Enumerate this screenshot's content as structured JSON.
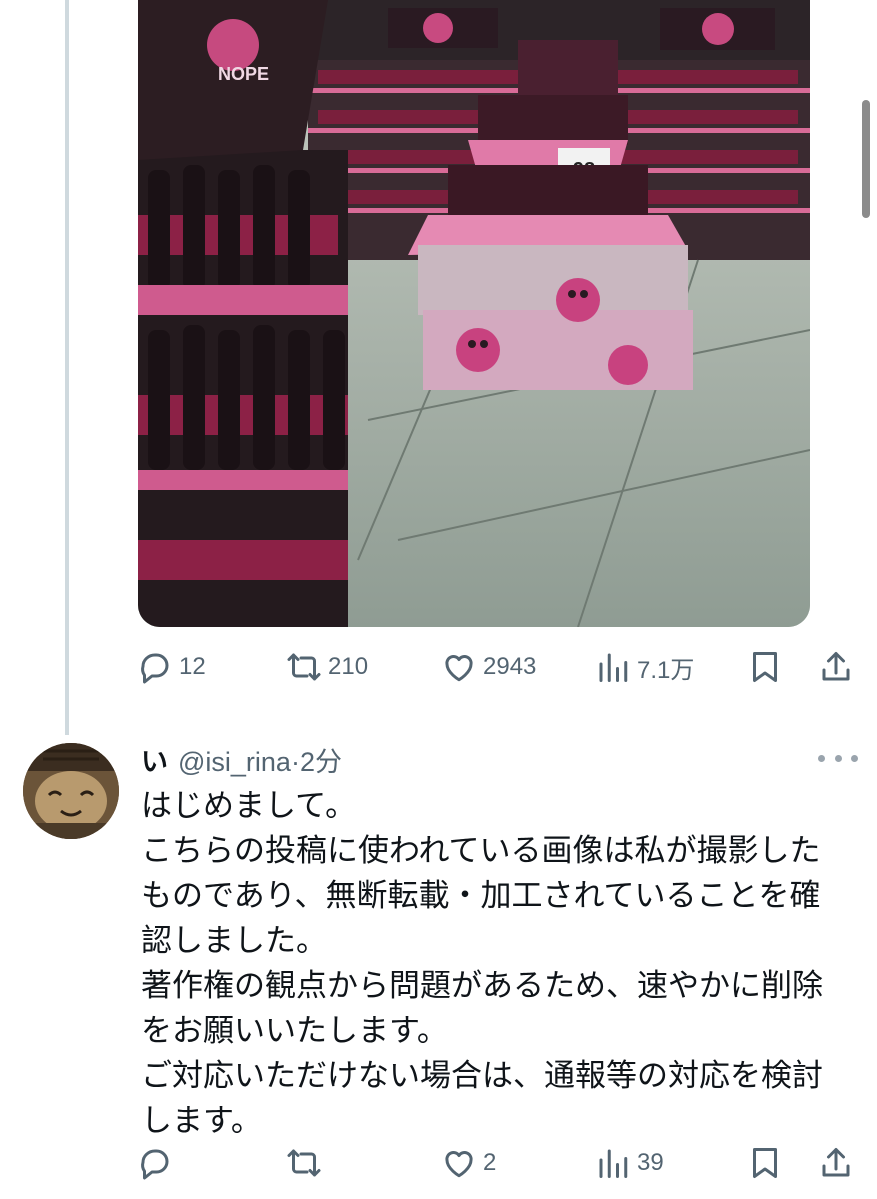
{
  "tweet": {
    "media": {
      "sign_text": "NOPE",
      "price_card": "98"
    },
    "actions": {
      "replies": "12",
      "retweets": "210",
      "likes": "2943",
      "views": "7.1万"
    }
  },
  "reply": {
    "display_name": "い",
    "handle": "@isi_rina",
    "separator": "·",
    "time": "2分",
    "body": [
      "はじめまして。",
      "こちらの投稿に使われている画像は私が撮影した",
      "ものであり、無断転載・加工されていることを確",
      "認しました。",
      "著作権の観点から問題があるため、速やかに削除",
      "をお願いいたします。",
      "ご対応いただけない場合は、通報等の対応を検討",
      "します。"
    ],
    "actions": {
      "replies": "",
      "retweets": "",
      "likes": "2",
      "views": "39"
    }
  },
  "colors": {
    "text_primary": "#0f1419",
    "text_secondary": "#536471",
    "thread_line": "#cfd9de",
    "product_pink": "#d9437e"
  },
  "icons": [
    "reply-icon",
    "retweet-icon",
    "like-icon",
    "views-icon",
    "bookmark-icon",
    "share-icon",
    "more-icon"
  ]
}
